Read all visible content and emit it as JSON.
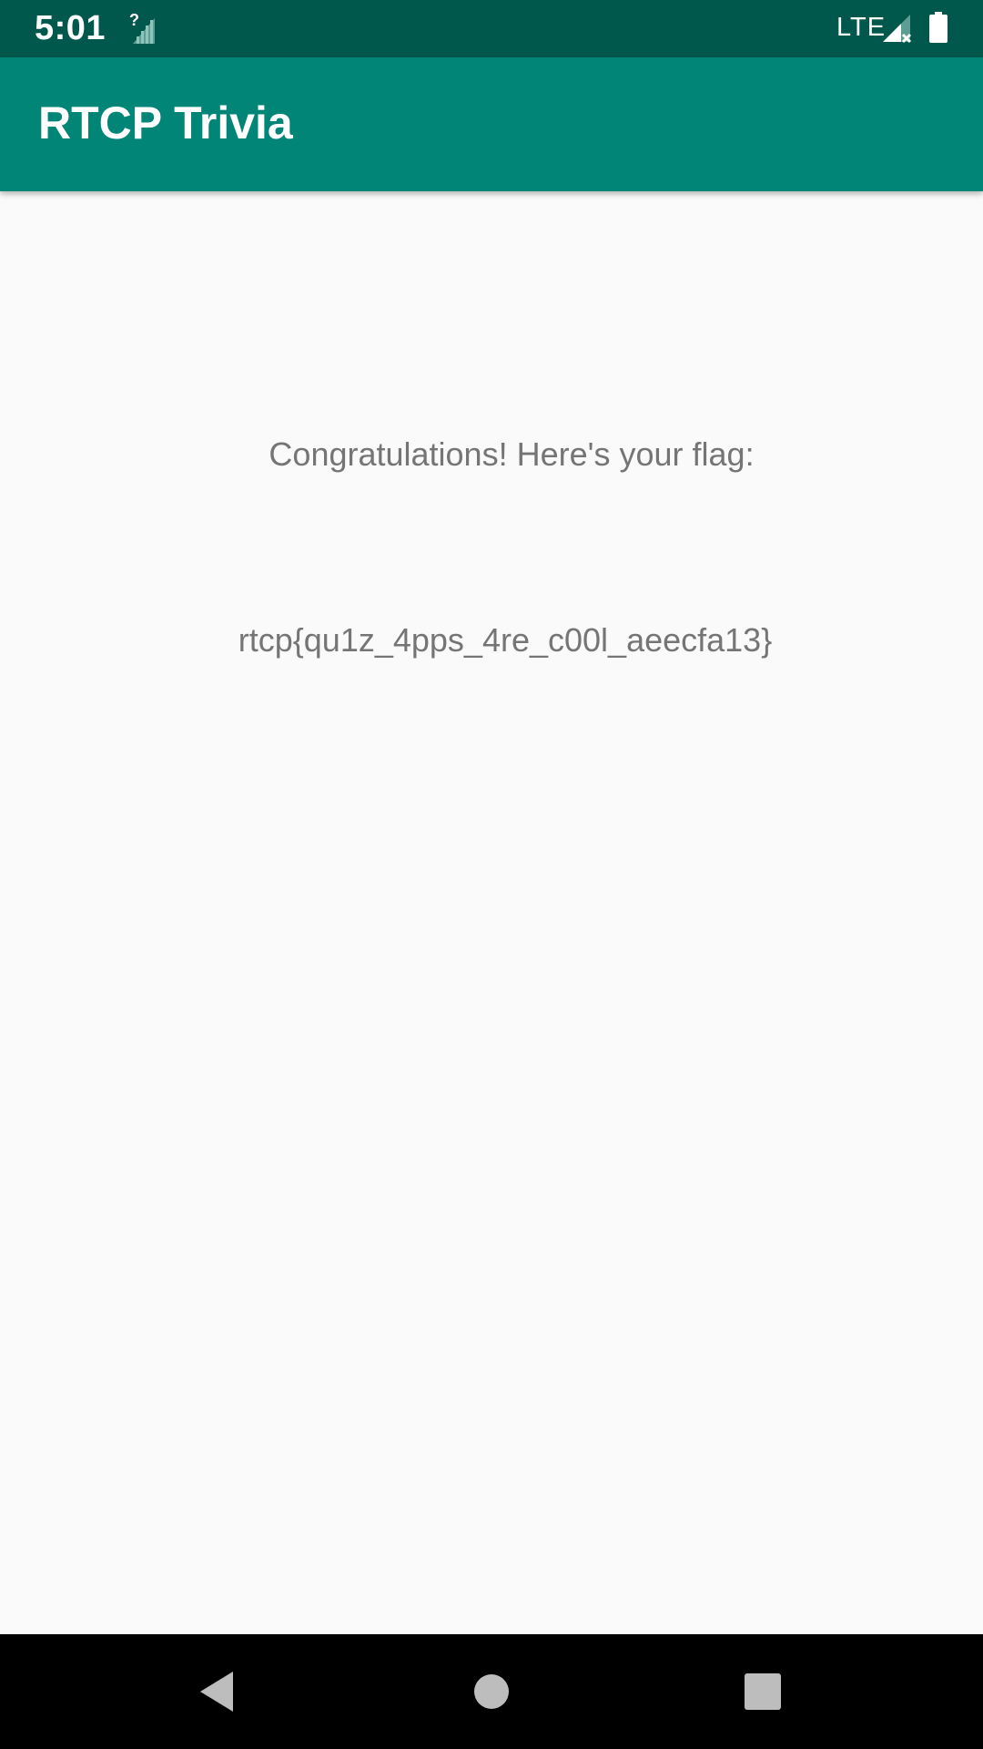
{
  "status_bar": {
    "time": "5:01",
    "network_label": "LTE",
    "icons": [
      "signal-unknown-icon",
      "cell-signal-no-data-icon",
      "battery-full-icon"
    ],
    "background_color": "#00574b"
  },
  "app_bar": {
    "title": "RTCP Trivia",
    "background_color": "#008577"
  },
  "main": {
    "message": "Congratulations! Here's your flag:",
    "flag": "rtcp{qu1z_4pps_4re_c00l_aeecfa13}",
    "text_color": "#757575",
    "background_color": "#fafafa"
  },
  "nav_bar": {
    "buttons": [
      "back-icon",
      "home-icon",
      "recents-icon"
    ]
  }
}
